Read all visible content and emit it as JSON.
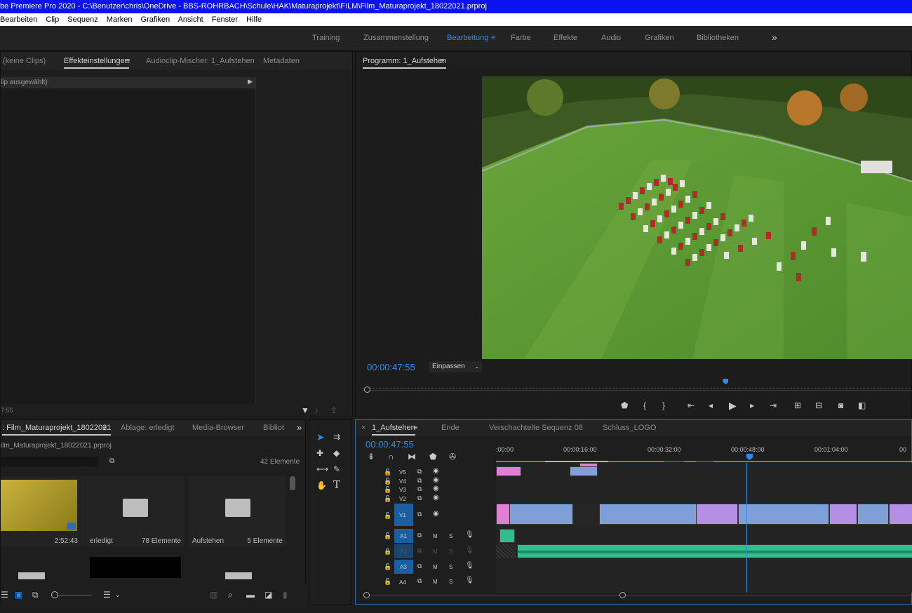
{
  "window": {
    "title": "be Premiere Pro 2020 - C:\\Benutzer\\chris\\OneDrive - BBS-ROHRBACH\\Schule\\HAK\\Maturaprojekt\\FILM\\Film_Maturaprojekt_18022021.prproj"
  },
  "menu": [
    "Bearbeiten",
    "Clip",
    "Sequenz",
    "Marken",
    "Grafiken",
    "Ansicht",
    "Fenster",
    "Hilfe"
  ],
  "workspaces": {
    "tabs": [
      "Training",
      "Zusammenstellung",
      "Bearbeitung",
      "Farbe",
      "Effekte",
      "Audio",
      "Grafiken",
      "Bibliotheken"
    ],
    "active": "Bearbeitung",
    "overflow": "»"
  },
  "effects_panel": {
    "tabs": [
      "(keine Clips)",
      "Effekteinstellungen",
      "Audioclip-Mischer: 1_Aufstehen",
      "Metadaten"
    ],
    "active": "Effekteinstellungen",
    "no_clip_text": "lip ausgewählt)",
    "timecode": "7:55"
  },
  "program_monitor": {
    "title": "Programm: 1_Aufstehen",
    "timecode": "00:00:47:55",
    "fit": "Einpassen",
    "playhead_percent": 66
  },
  "project_panel": {
    "tabs": [
      ": Film_Maturaprojekt_18022021",
      "Ablage: erledigt",
      "Media-Browser",
      "Bibliot"
    ],
    "path": "ilm_Maturaprojekt_18022021.prproj",
    "count": "42 Elemente",
    "items": [
      {
        "name": "",
        "meta": "2:52:43",
        "type": "video"
      },
      {
        "name": "erledigt",
        "meta": "78 Elemente",
        "type": "folder"
      },
      {
        "name": "Aufstehen",
        "meta": "5 Elemente",
        "type": "folder"
      }
    ]
  },
  "timeline": {
    "tabs": [
      "1_Aufstehen",
      "Ende",
      "Verschachtelte Sequenz 08",
      "Schluss_LOGO"
    ],
    "active": "1_Aufstehen",
    "timecode": "00:00:47:55",
    "ruler": [
      ":00:00",
      "00:00:16:00",
      "00:00:32:00",
      "00:00:48:00",
      "00:01:04:00",
      "00"
    ],
    "video_tracks": [
      "V5",
      "V4",
      "V3",
      "V2",
      "V1"
    ],
    "audio_tracks": [
      "A1",
      "A2",
      "A3",
      "A4"
    ],
    "track_buttons": {
      "mute": "M",
      "solo": "S"
    }
  },
  "colors": {
    "accent": "#2d8ceb",
    "title_bar": "#0a12f0",
    "video_clip": "#7f9fd8",
    "pink_clip": "#e07fd6",
    "audio_clip": "#2fbf8f",
    "purple_clip": "#b58ee6"
  }
}
